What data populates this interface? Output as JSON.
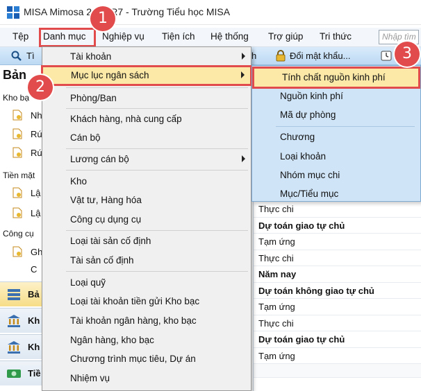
{
  "window": {
    "title": "MISA Mimosa 2015 R7 - Trường Tiểu học MISA"
  },
  "menubar": {
    "items": [
      "Tệp",
      "Danh mục",
      "Nghiệp vụ",
      "Tiện ích",
      "Hệ thống",
      "Trợ giúp",
      "Tri thức"
    ],
    "search_placeholder": "Nhập tìm"
  },
  "toolbar": {
    "items": [
      "Tì",
      "h",
      "Đổi mật khẩu..."
    ]
  },
  "left_pane": {
    "heading": "Bản",
    "groups": [
      "Kho bạ",
      "Tiền mặt",
      "Công cụ"
    ],
    "links": [
      "Nh",
      "Rú",
      "Rú",
      "Lậ",
      "Lậ",
      "Gh",
      "C"
    ],
    "nav": [
      "Bả",
      "Kh",
      "Kh",
      "Tiề"
    ]
  },
  "danh_muc_menu": {
    "items": [
      "Tài khoản",
      "Mục lục ngân sách",
      "Phòng/Ban",
      "Khách hàng, nhà cung cấp",
      "Cán bộ",
      "Lương cán bộ",
      "Kho",
      "Vật tư, Hàng hóa",
      "Công cụ dụng cụ",
      "Loại tài sản cố định",
      "Tài sản cố định",
      "Loại quỹ",
      "Loại tài khoản tiền gửi Kho bạc",
      "Tài khoản ngân hàng, kho bạc",
      "Ngân hàng, kho bạc",
      "Chương trình mục tiêu, Dự án",
      "Nhiệm vụ"
    ]
  },
  "submenu": {
    "items": [
      "Tính chất nguồn kinh phí",
      "Nguồn kinh phí",
      "Mã dự phòng",
      "Chương",
      "Loại khoản",
      "Nhóm mục chi",
      "Mục/Tiểu mục"
    ]
  },
  "grid_rows": [
    "Thực chi",
    "Dự toán giao tự chủ",
    "Tạm ứng",
    "Thực chi",
    "Năm nay",
    "Dự toán không giao tự chủ",
    "Tạm ứng",
    "Thực chi",
    "Dự toán giao tự chủ",
    "Tạm ứng"
  ],
  "callouts": [
    "1",
    "2",
    "3"
  ],
  "colors": {
    "accent_red": "#e24b4b",
    "highlight": "#fce9a8",
    "submenu_bg": "#cfe4f7"
  }
}
